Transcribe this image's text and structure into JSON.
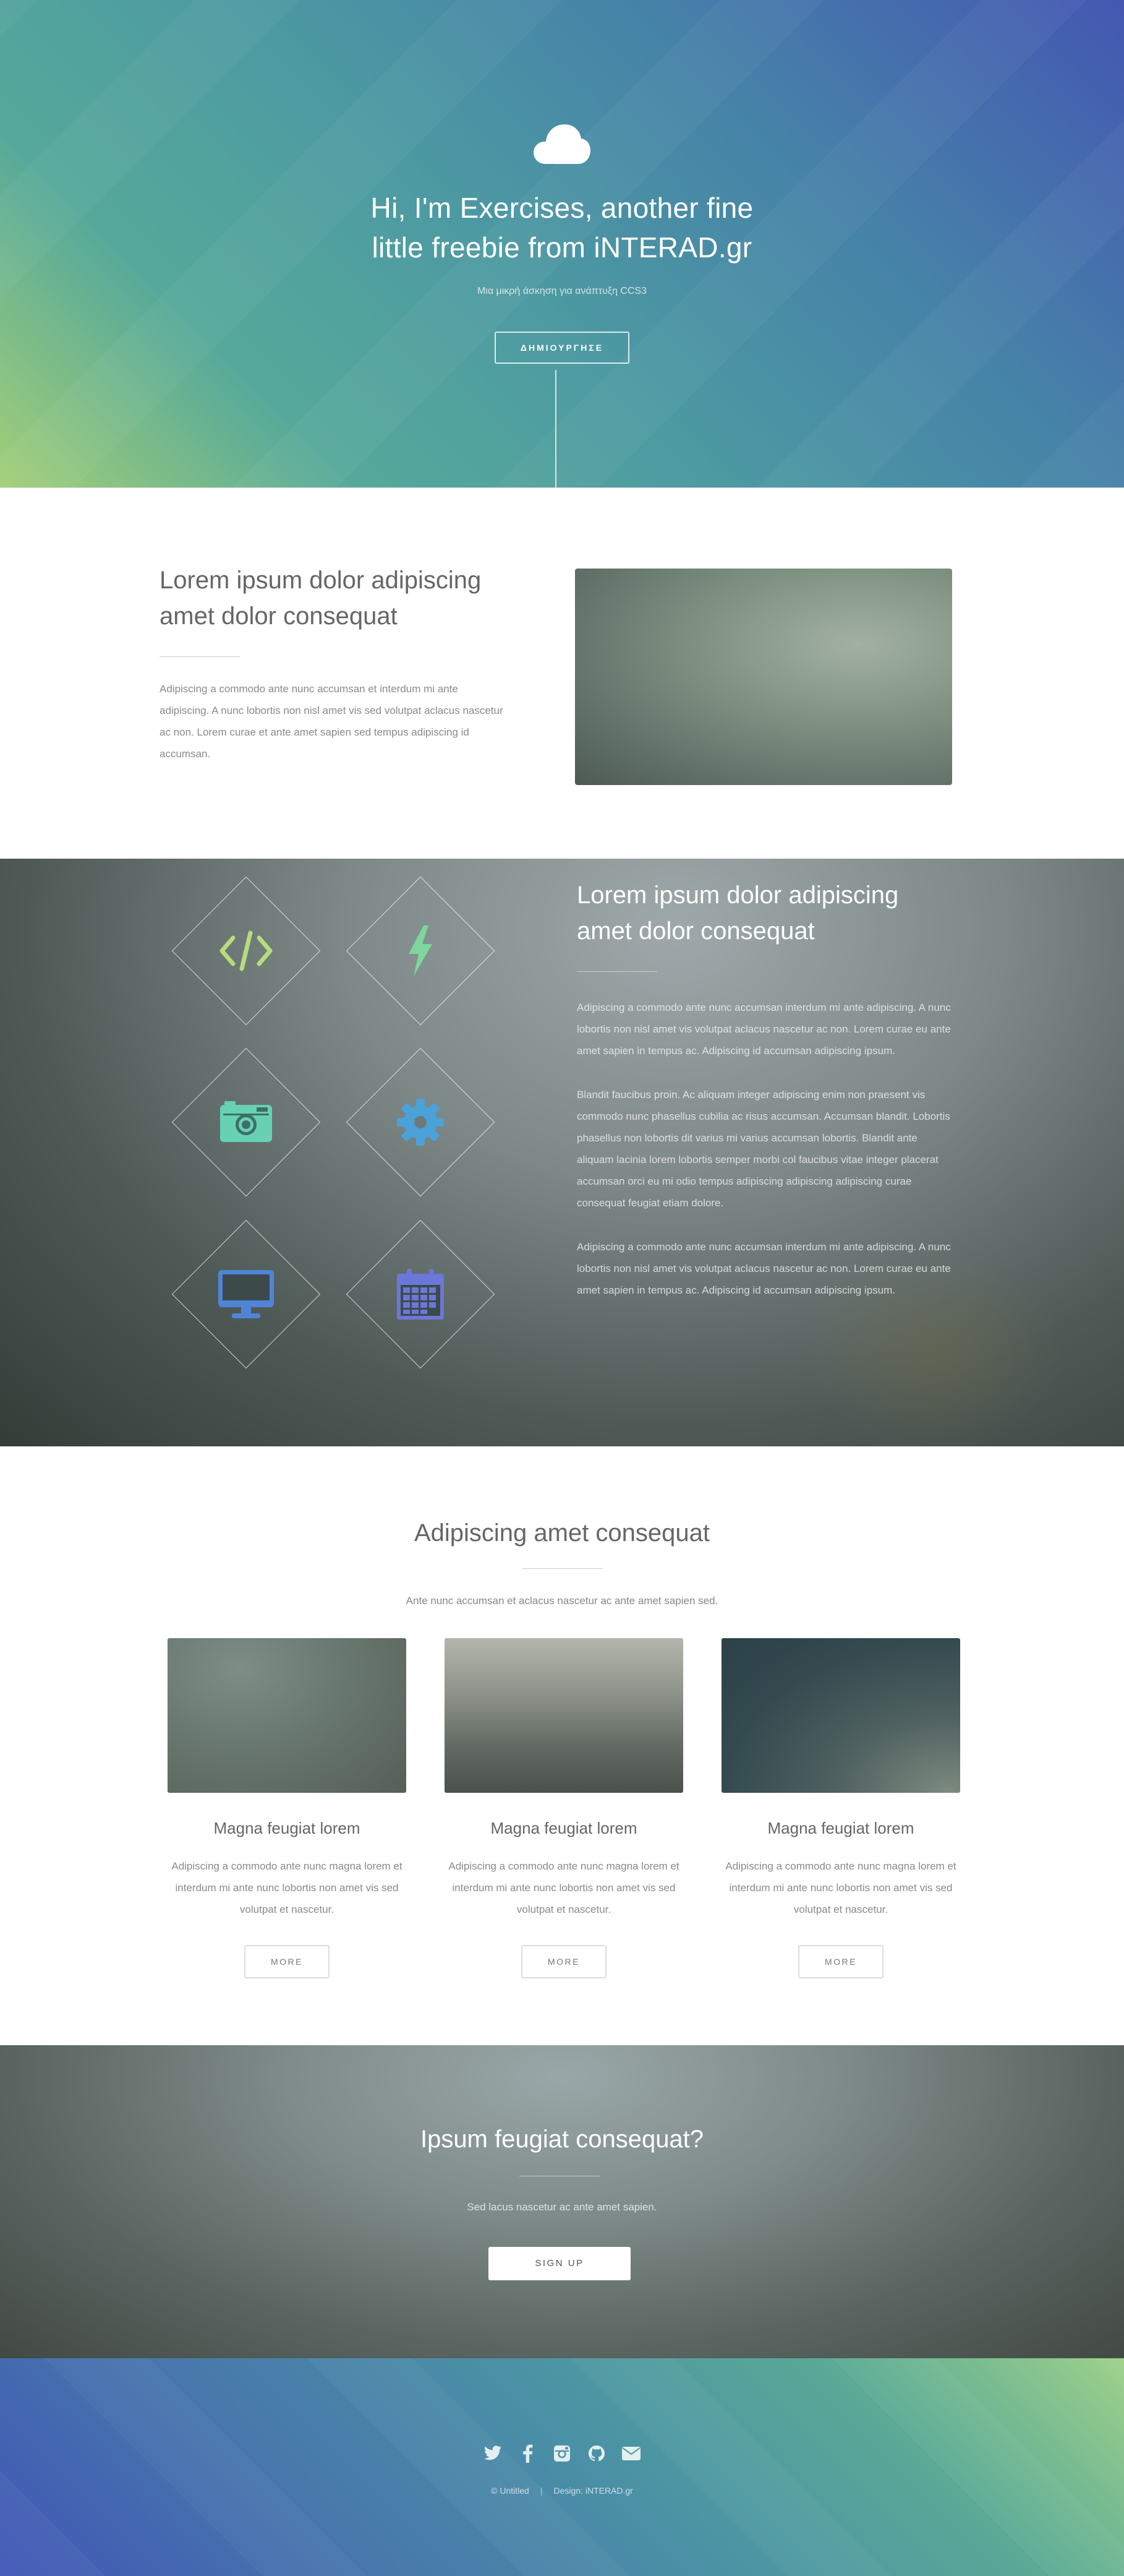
{
  "hero": {
    "title_part1": "Hi, I'm ",
    "title_bold": "Exercises",
    "title_part2": ", another fine",
    "title_line2": "little freebie from iNTERAD.gr",
    "subtitle": "Μια μικρή άσκηση για ανάπτυξη CCS3",
    "button": "ΔΗΜΙΟΥΡΓΗΣΕ",
    "icon": "cloud-icon"
  },
  "intro": {
    "title": "Lorem ipsum dolor adipiscing amet dolor consequat",
    "text": "Adipiscing a commodo ante nunc accumsan et interdum mi ante adipiscing. A nunc lobortis non nisl amet vis sed volutpat aclacus nascetur ac non. Lorem curae et ante amet sapien sed tempus adipiscing id accumsan."
  },
  "features": {
    "icons": [
      "code-icon",
      "bolt-icon",
      "camera-retro-icon",
      "gear-icon",
      "desktop-icon",
      "calendar-icon"
    ],
    "icon_colors": [
      "#b5dd7c",
      "#7ed59d",
      "#67d1b4",
      "#4aa2d8",
      "#4f85d8",
      "#6b77d9"
    ],
    "title": "Lorem ipsum dolor adipiscing amet dolor consequat",
    "paragraphs": [
      "Adipiscing a commodo ante nunc accumsan interdum mi ante adipiscing. A nunc lobortis non nisl amet vis volutpat aclacus nascetur ac non. Lorem curae eu ante amet sapien in tempus ac. Adipiscing id accumsan adipiscing ipsum.",
      "Blandit faucibus proin. Ac aliquam integer adipiscing enim non praesent vis commodo nunc phasellus cubilia ac risus accumsan. Accumsan blandit. Lobortis phasellus non lobortis dit varius mi varius accumsan lobortis. Blandit ante aliquam lacinia lorem lobortis semper morbi col faucibus vitae integer placerat accumsan orci eu mi odio tempus adipiscing adipiscing adipiscing curae consequat feugiat etiam dolore.",
      "Adipiscing a commodo ante nunc accumsan interdum mi ante adipiscing. A nunc lobortis non nisl amet vis volutpat aclacus nascetur ac non. Lorem curae eu ante amet sapien in tempus ac. Adipiscing id accumsan adipiscing ipsum."
    ]
  },
  "services": {
    "title": "Adipiscing amet consequat",
    "lead": "Ante nunc accumsan et aclacus nascetur ac ante amet sapien sed.",
    "cards": [
      {
        "title": "Magna feugiat lorem",
        "text": "Adipiscing a commodo ante nunc magna lorem et interdum mi ante nunc lobortis non amet vis sed volutpat et nascetur.",
        "button": "MORE"
      },
      {
        "title": "Magna feugiat lorem",
        "text": "Adipiscing a commodo ante nunc magna lorem et interdum mi ante nunc lobortis non amet vis sed volutpat et nascetur.",
        "button": "MORE"
      },
      {
        "title": "Magna feugiat lorem",
        "text": "Adipiscing a commodo ante nunc magna lorem et interdum mi ante nunc lobortis non amet vis sed volutpat et nascetur.",
        "button": "MORE"
      }
    ]
  },
  "cta": {
    "title": "Ipsum feugiat consequat?",
    "lead": "Sed lacus nascetur ac ante amet sapien.",
    "button": "SIGN UP"
  },
  "footer": {
    "socials": [
      "twitter-icon",
      "facebook-icon",
      "instagram-icon",
      "github-icon",
      "envelope-icon"
    ],
    "copyright": "© Untitled",
    "separator": "|",
    "design": "Design: iNTERAD.gr"
  }
}
